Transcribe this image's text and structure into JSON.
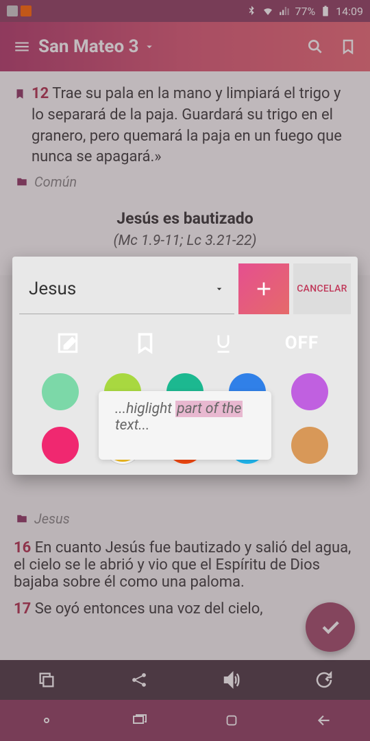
{
  "status": {
    "bluetooth": "bluetooth-icon",
    "wifi": "wifi-icon",
    "signal": "signal-icon",
    "battery_pct": "77%",
    "battery_icon": "battery-icon",
    "time": "14:09"
  },
  "appbar": {
    "title": "San Mateo 3"
  },
  "verse12": {
    "num": "12",
    "text": "Trae su pala en la mano y limpiará el trigo y lo separará de la paja. Guardará su trigo en el granero, pero quemará la paja en un fuego que nunca se apagará.»",
    "tag": "Común"
  },
  "section": {
    "title": "Jesús es bautizado",
    "ref": "(Mc 1.9-11; Lc 3.21-22)"
  },
  "dialog": {
    "dropdown_value": "Jesus",
    "cancel": "CANCELAR",
    "off": "OFF",
    "hint_pre": "...higlight ",
    "hint_hl": "part of the",
    "hint_post": " text..."
  },
  "lower": {
    "tag": "Jesus",
    "v16num": "16",
    "v16text": "En cuanto Jesús fue bautizado y salió del agua, el cielo se le abrió y vio que el Espíritu de Dios bajaba sobre él como una paloma.",
    "v17num": "17",
    "v17text": "Se oyó entonces una voz del cielo,"
  },
  "partial": {
    "v13": "1",
    "v14": "1",
    "v15": "1"
  }
}
